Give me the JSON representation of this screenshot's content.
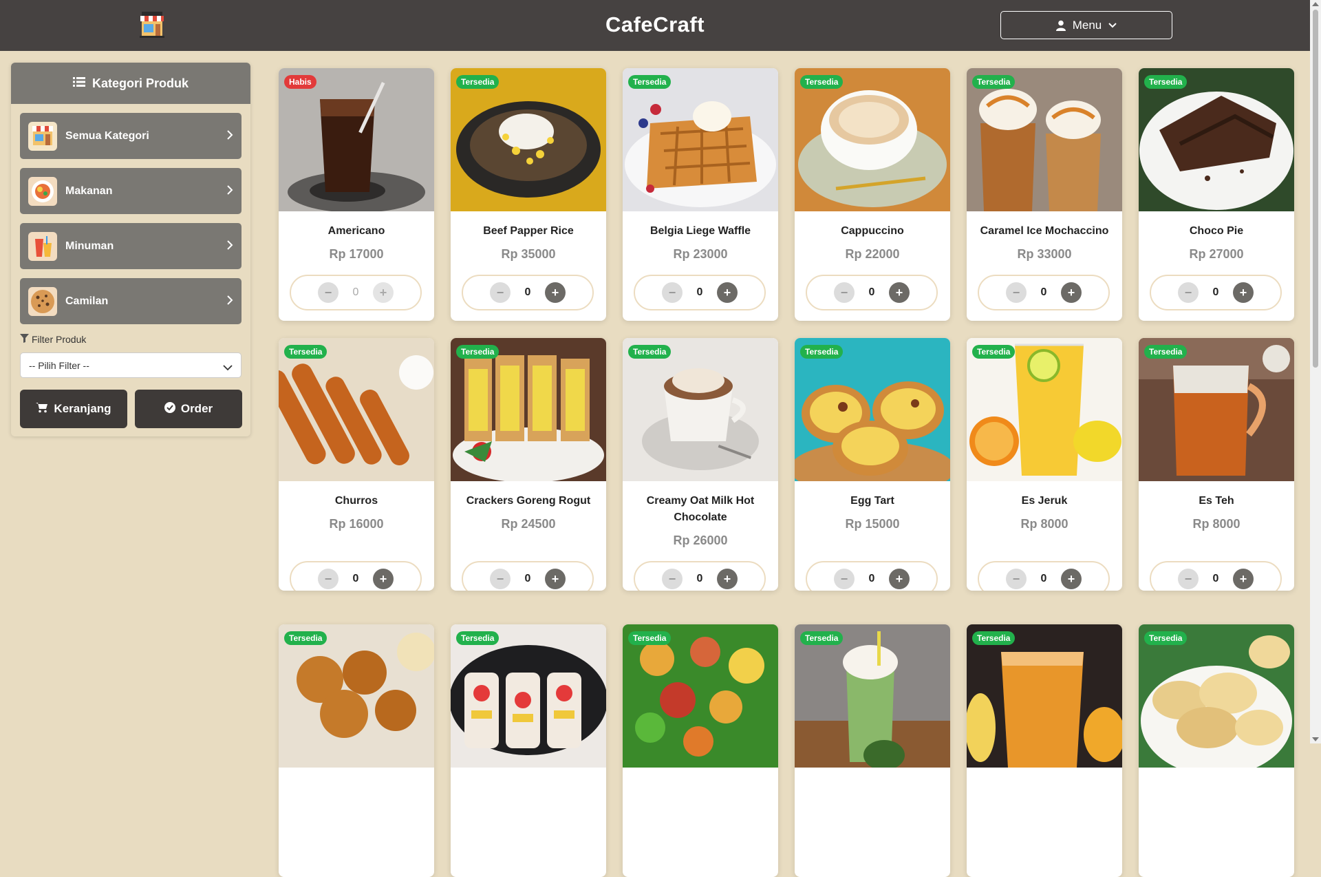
{
  "header": {
    "title": "CafeCraft",
    "menu_label": "Menu"
  },
  "sidebar": {
    "heading": "Kategori Produk",
    "categories": [
      {
        "label": "Semua Kategori",
        "icon": "store-icon"
      },
      {
        "label": "Makanan",
        "icon": "food-plate-icon"
      },
      {
        "label": "Minuman",
        "icon": "drink-icon"
      },
      {
        "label": "Camilan",
        "icon": "cookie-icon"
      }
    ],
    "filter_label": "Filter Produk",
    "filter_placeholder": "-- Pilih Filter --",
    "cart_label": "Keranjang",
    "order_label": "Order"
  },
  "products": [
    {
      "name": "Americano",
      "price": "Rp 17000",
      "status": "Habis",
      "qty": "0"
    },
    {
      "name": "Beef Papper Rice",
      "price": "Rp 35000",
      "status": "Tersedia",
      "qty": "0"
    },
    {
      "name": "Belgia Liege Waffle",
      "price": "Rp 23000",
      "status": "Tersedia",
      "qty": "0"
    },
    {
      "name": "Cappuccino",
      "price": "Rp 22000",
      "status": "Tersedia",
      "qty": "0"
    },
    {
      "name": "Caramel Ice Mochaccino",
      "price": "Rp 33000",
      "status": "Tersedia",
      "qty": "0"
    },
    {
      "name": "Choco Pie",
      "price": "Rp 27000",
      "status": "Tersedia",
      "qty": "0"
    },
    {
      "name": "Churros",
      "price": "Rp 16000",
      "status": "Tersedia",
      "qty": "0"
    },
    {
      "name": "Crackers Goreng Rogut",
      "price": "Rp 24500",
      "status": "Tersedia",
      "qty": "0"
    },
    {
      "name": "Creamy Oat Milk Hot Chocolate",
      "price": "Rp 26000",
      "status": "Tersedia",
      "qty": "0"
    },
    {
      "name": "Egg Tart",
      "price": "Rp 15000",
      "status": "Tersedia",
      "qty": "0"
    },
    {
      "name": "Es Jeruk",
      "price": "Rp 8000",
      "status": "Tersedia",
      "qty": "0"
    },
    {
      "name": "Es Teh",
      "price": "Rp 8000",
      "status": "Tersedia",
      "qty": "0"
    },
    {
      "name": "",
      "price": "",
      "status": "Tersedia",
      "qty": ""
    },
    {
      "name": "",
      "price": "",
      "status": "Tersedia",
      "qty": ""
    },
    {
      "name": "",
      "price": "",
      "status": "Tersedia",
      "qty": ""
    },
    {
      "name": "",
      "price": "",
      "status": "Tersedia",
      "qty": ""
    },
    {
      "name": "",
      "price": "",
      "status": "Tersedia",
      "qty": ""
    },
    {
      "name": "",
      "price": "",
      "status": "Tersedia",
      "qty": ""
    }
  ],
  "colors": {
    "header_bg": "#464241",
    "page_bg": "#e8dcc1",
    "sidebar_item_bg": "#7a7873",
    "available_badge": "#22b14c",
    "soldout_badge": "#e23a3a"
  }
}
